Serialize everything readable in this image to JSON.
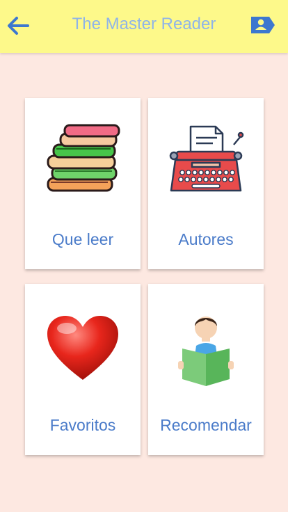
{
  "header": {
    "title": "The Master Reader",
    "back_icon": "arrow-left-icon",
    "profile_icon": "contact-card-icon",
    "background": "#fdf98a",
    "accent": "#4a7bc9"
  },
  "menu": {
    "items": [
      {
        "label": "Que leer",
        "icon": "books-stack-icon"
      },
      {
        "label": "Autores",
        "icon": "typewriter-icon"
      },
      {
        "label": "Favoritos",
        "icon": "heart-icon"
      },
      {
        "label": "Recomendar",
        "icon": "person-reading-icon"
      }
    ]
  },
  "colors": {
    "page_background": "#fde8e1",
    "card_background": "#ffffff",
    "label_text": "#4a7bc9"
  }
}
